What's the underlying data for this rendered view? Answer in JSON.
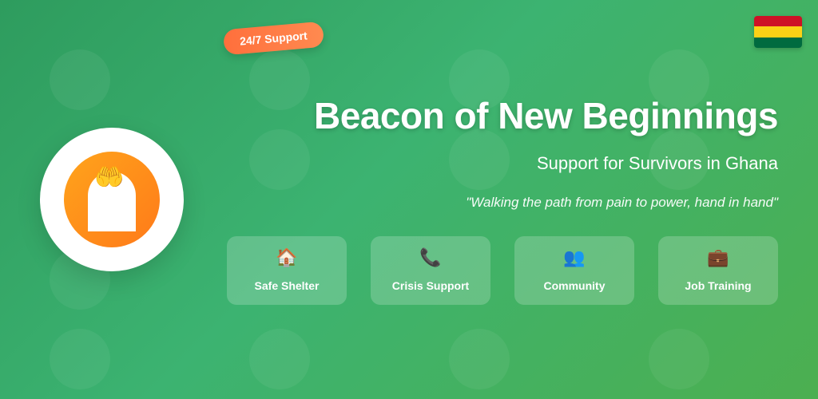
{
  "badge": {
    "label": "24/7 Support"
  },
  "flag": {
    "name": "ghana-flag",
    "colors": [
      "#ce1126",
      "#fcd116",
      "#006b3f"
    ]
  },
  "logo": {
    "icon": "raised-hands-icon",
    "glyph": "🤲"
  },
  "title": "Beacon of New Beginnings",
  "subtitle": "Support for Survivors in Ghana",
  "quote": "\"Walking the path from pain to power, hand in hand\"",
  "services": [
    {
      "icon": "house-icon",
      "glyph": "🏠",
      "label": "Safe Shelter"
    },
    {
      "icon": "phone-icon",
      "glyph": "📞",
      "label": "Crisis Support"
    },
    {
      "icon": "people-icon",
      "glyph": "👥",
      "label": "Community"
    },
    {
      "icon": "briefcase-icon",
      "glyph": "💼",
      "label": "Job Training"
    }
  ],
  "colors": {
    "background_start": "#2e9c5e",
    "background_end": "#4caf50",
    "badge": "#ff7043",
    "logo_fill": "#ff8c1a"
  }
}
